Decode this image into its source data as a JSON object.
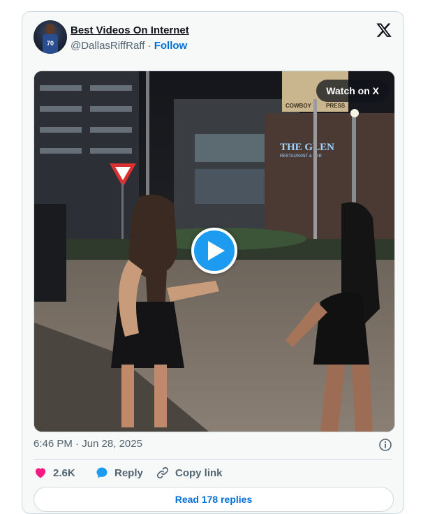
{
  "author": {
    "name": "Best Videos On Internet",
    "handle": "@DallasRiffRaff",
    "separator": "·",
    "follow_label": "Follow",
    "avatar_jersey": "70"
  },
  "media": {
    "watch_label": "Watch on X",
    "sign_left": "COWBOY",
    "sign_right": "PRESS",
    "store_sign": "THE GLEN",
    "store_sub": "RESTAURANT & BAR"
  },
  "tweet": {
    "timestamp": "6:46 PM · Jun 28, 2025"
  },
  "actions": {
    "like_count": "2.6K",
    "reply_label": "Reply",
    "copy_label": "Copy link"
  },
  "footer": {
    "read_replies_label": "Read 178 replies"
  },
  "colors": {
    "accent": "#1d9bf0",
    "link": "#006fd6",
    "like": "#f91880",
    "muted": "#536471"
  }
}
